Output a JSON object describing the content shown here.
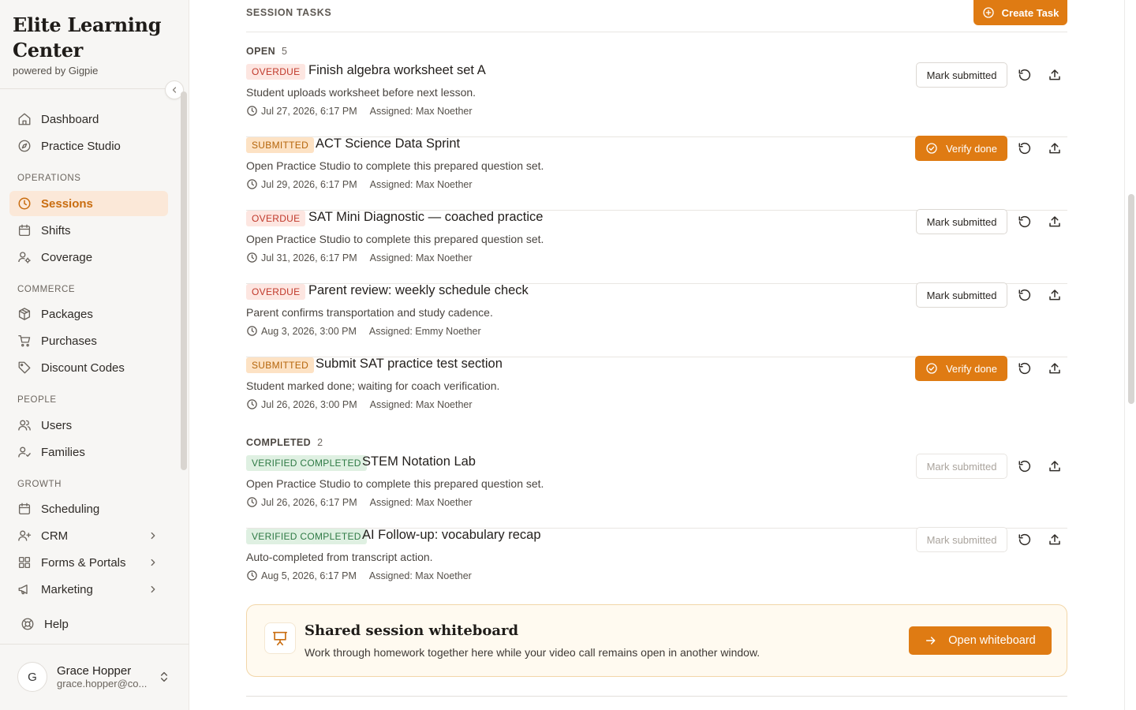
{
  "brand": {
    "title": "Elite Learning Center",
    "subtitle": "powered by Gigpie"
  },
  "nav": {
    "items": [
      {
        "label": "Dashboard",
        "icon": "home-icon"
      },
      {
        "label": "Practice Studio",
        "icon": "compass-icon"
      }
    ],
    "sections": [
      {
        "label": "OPERATIONS",
        "items": [
          {
            "label": "Sessions",
            "icon": "clock-icon",
            "active": true
          },
          {
            "label": "Shifts",
            "icon": "calendar-icon"
          },
          {
            "label": "Coverage",
            "icon": "user-gear-icon"
          }
        ]
      },
      {
        "label": "COMMERCE",
        "items": [
          {
            "label": "Packages",
            "icon": "package-icon"
          },
          {
            "label": "Purchases",
            "icon": "cart-icon"
          },
          {
            "label": "Discount Codes",
            "icon": "tag-icon"
          }
        ]
      },
      {
        "label": "PEOPLE",
        "items": [
          {
            "label": "Users",
            "icon": "users-icon"
          },
          {
            "label": "Families",
            "icon": "user-check-icon"
          }
        ]
      },
      {
        "label": "GROWTH",
        "items": [
          {
            "label": "Scheduling",
            "icon": "calendar-icon"
          },
          {
            "label": "CRM",
            "icon": "user-plus-icon"
          },
          {
            "label": "Forms & Portals",
            "icon": "grid-icon"
          },
          {
            "label": "Marketing",
            "icon": "megaphone-icon"
          }
        ]
      }
    ],
    "help": "Help"
  },
  "user": {
    "initial": "G",
    "name": "Grace Hopper",
    "email": "grace.hopper@co..."
  },
  "tasks": {
    "heading": "SESSION TASKS",
    "create_label": "Create Task",
    "open": {
      "label": "OPEN",
      "count": "5",
      "items": [
        {
          "status": "OVERDUE",
          "title": "Finish algebra worksheet set A",
          "desc": "Student uploads worksheet before next lesson.",
          "date": "Jul 27, 2026, 6:17 PM",
          "assigned": "Assigned: Max Noether",
          "action": "Mark submitted"
        },
        {
          "status": "SUBMITTED",
          "title": "ACT Science Data Sprint",
          "desc": "Open Practice Studio to complete this prepared question set.",
          "date": "Jul 29, 2026, 6:17 PM",
          "assigned": "Assigned: Max Noether",
          "action": "Verify done"
        },
        {
          "status": "OVERDUE",
          "title": "SAT Mini Diagnostic — coached practice",
          "desc": "Open Practice Studio to complete this prepared question set.",
          "date": "Jul 31, 2026, 6:17 PM",
          "assigned": "Assigned: Max Noether",
          "action": "Mark submitted"
        },
        {
          "status": "OVERDUE",
          "title": "Parent review: weekly schedule check",
          "desc": "Parent confirms transportation and study cadence.",
          "date": "Aug 3, 2026, 3:00 PM",
          "assigned": "Assigned: Emmy Noether",
          "action": "Mark submitted"
        },
        {
          "status": "SUBMITTED",
          "title": "Submit SAT practice test section",
          "desc": "Student marked done; waiting for coach verification.",
          "date": "Jul 26, 2026, 3:00 PM",
          "assigned": "Assigned: Max Noether",
          "action": "Verify done"
        }
      ]
    },
    "completed": {
      "label": "COMPLETED",
      "count": "2",
      "items": [
        {
          "status": "VERIFIED COMPLETED",
          "title": "STEM Notation Lab",
          "desc": "Open Practice Studio to complete this prepared question set.",
          "date": "Jul 26, 2026, 6:17 PM",
          "assigned": "Assigned: Max Noether",
          "action": "Mark submitted"
        },
        {
          "status": "VERIFIED COMPLETED",
          "title": "AI Follow-up: vocabulary recap",
          "desc": "Auto-completed from transcript action.",
          "date": "Aug 5, 2026, 6:17 PM",
          "assigned": "Assigned: Max Noether",
          "action": "Mark submitted"
        }
      ]
    }
  },
  "whiteboard": {
    "title": "Shared session whiteboard",
    "desc": "Work through homework together here while your video call remains open in another window.",
    "button": "Open whiteboard"
  },
  "colors": {
    "accent": "#df7b13",
    "active_bg": "#fbe8d8",
    "overdue": "#c0392b",
    "verified": "#2f7a45"
  }
}
